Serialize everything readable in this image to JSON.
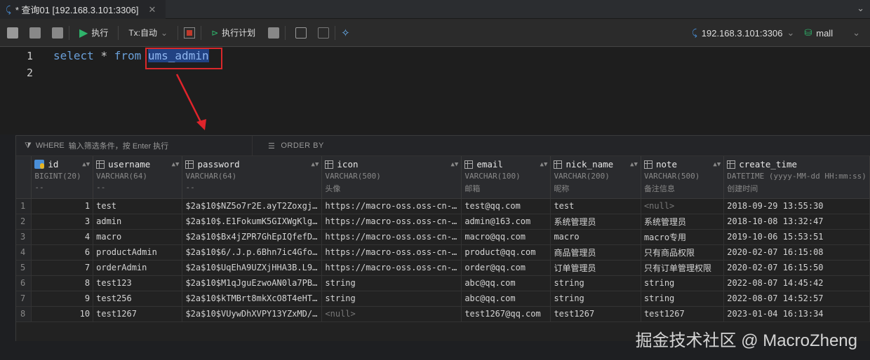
{
  "tab": {
    "title": "* 查询01 [192.168.3.101:3306]"
  },
  "toolbar": {
    "run": "执行",
    "tx": "Tx:自动",
    "plan": "执行计划"
  },
  "connection": {
    "host": "192.168.3.101:3306",
    "database": "mall"
  },
  "editor": {
    "lines": [
      "1",
      "2"
    ],
    "kw1": "select",
    "star": "*",
    "kw2": "from",
    "table": "ums_admin"
  },
  "results": {
    "where_label": "WHERE",
    "where_placeholder": "输入筛选条件，按 Enter 执行",
    "order_label": "ORDER BY",
    "columns": [
      {
        "name": "id",
        "type": "BIGINT(20)",
        "comment": "--"
      },
      {
        "name": "username",
        "type": "VARCHAR(64)",
        "comment": "--"
      },
      {
        "name": "password",
        "type": "VARCHAR(64)",
        "comment": "--"
      },
      {
        "name": "icon",
        "type": "VARCHAR(500)",
        "comment": "头像"
      },
      {
        "name": "email",
        "type": "VARCHAR(100)",
        "comment": "邮箱"
      },
      {
        "name": "nick_name",
        "type": "VARCHAR(200)",
        "comment": "昵称"
      },
      {
        "name": "note",
        "type": "VARCHAR(500)",
        "comment": "备注信息"
      },
      {
        "name": "create_time",
        "type": "DATETIME (yyyy-MM-dd HH:mm:ss)",
        "comment": "创建时间"
      }
    ],
    "rows": [
      [
        "1",
        "1",
        "test",
        "$2a$10$NZ5o7r2E.ayT2Zoxgj…",
        "https://macro-oss.oss-cn-…",
        "test@qq.com",
        "test",
        "<null>",
        "2018-09-29 13:55:30"
      ],
      [
        "2",
        "3",
        "admin",
        "$2a$10$.E1FokumK5GIXWgKlg…",
        "https://macro-oss.oss-cn-…",
        "admin@163.com",
        "系统管理员",
        "系统管理员",
        "2018-10-08 13:32:47"
      ],
      [
        "3",
        "4",
        "macro",
        "$2a$10$Bx4jZPR7GhEpIQfefD…",
        "https://macro-oss.oss-cn-…",
        "macro@qq.com",
        "macro",
        "macro专用",
        "2019-10-06 15:53:51"
      ],
      [
        "4",
        "6",
        "productAdmin",
        "$2a$10$6/.J.p.6Bhn7ic4Gfo…",
        "https://macro-oss.oss-cn-…",
        "product@qq.com",
        "商品管理员",
        "只有商品权限",
        "2020-02-07 16:15:08"
      ],
      [
        "5",
        "7",
        "orderAdmin",
        "$2a$10$UqEhA9UZXjHHA3B.L9…",
        "https://macro-oss.oss-cn-…",
        "order@qq.com",
        "订单管理员",
        "只有订单管理权限",
        "2020-02-07 16:15:50"
      ],
      [
        "6",
        "8",
        "test123",
        "$2a$10$M1qJguEzwoAN0la7PB…",
        "string",
        "abc@qq.com",
        "string",
        "string",
        "2022-08-07 14:45:42"
      ],
      [
        "7",
        "9",
        "test256",
        "$2a$10$kTMBrt8mkXcO8T4eHT…",
        "string",
        "abc@qq.com",
        "string",
        "string",
        "2022-08-07 14:52:57"
      ],
      [
        "8",
        "10",
        "test1267",
        "$2a$10$VUywDhXVPY13YZxMD/…",
        "<null>",
        "test1267@qq.com",
        "test1267",
        "test1267",
        "2023-01-04 16:13:34"
      ]
    ]
  },
  "watermark": "掘金技术社区 @ MacroZheng"
}
